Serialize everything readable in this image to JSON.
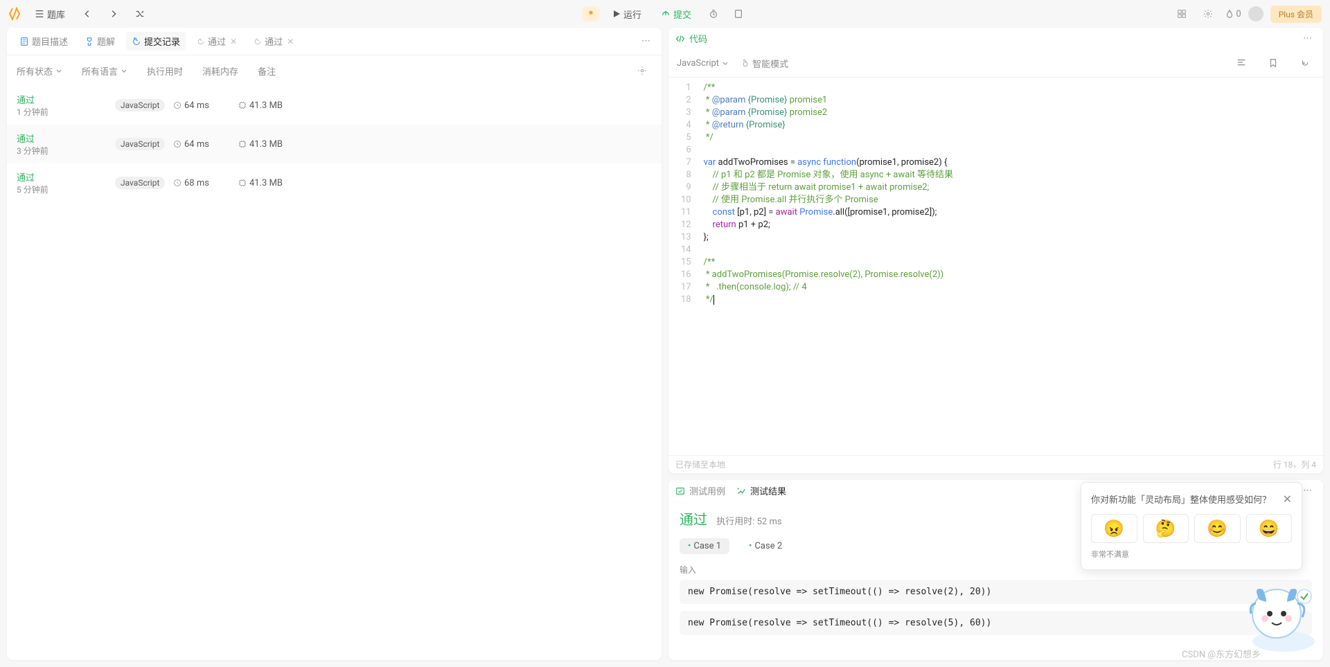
{
  "topbar": {
    "problems_label": "题库",
    "run_label": "运行",
    "submit_label": "提交",
    "fire_count": "0",
    "plus_label": "Plus 会员"
  },
  "left_tabs": {
    "desc": "题目描述",
    "solution": "题解",
    "submissions": "提交记录",
    "accepted1": "通过",
    "accepted2": "通过"
  },
  "filters": {
    "status": "所有状态",
    "lang": "所有语言",
    "runtime": "执行用时",
    "memory": "消耗内存",
    "notes": "备注"
  },
  "submissions": [
    {
      "status": "通过",
      "ago": "1 分钟前",
      "lang": "JavaScript",
      "time": "64 ms",
      "mem": "41.3 MB"
    },
    {
      "status": "通过",
      "ago": "3 分钟前",
      "lang": "JavaScript",
      "time": "64 ms",
      "mem": "41.3 MB"
    },
    {
      "status": "通过",
      "ago": "5 分钟前",
      "lang": "JavaScript",
      "time": "68 ms",
      "mem": "41.3 MB"
    }
  ],
  "code_header": {
    "title": "代码",
    "lang": "JavaScript",
    "smart_mode": "智能模式"
  },
  "code_lines": [
    {
      "n": 1,
      "html": "<span class='c-comment'>/**</span>"
    },
    {
      "n": 2,
      "html": "<span class='c-comment'> * </span><span class='c-tag'>@param</span><span class='c-comment'> </span><span class='c-type'>{Promise}</span><span class='c-comment'> promise1</span>"
    },
    {
      "n": 3,
      "html": "<span class='c-comment'> * </span><span class='c-tag'>@param</span><span class='c-comment'> </span><span class='c-type'>{Promise}</span><span class='c-comment'> promise2</span>"
    },
    {
      "n": 4,
      "html": "<span class='c-comment'> * </span><span class='c-tag'>@return</span><span class='c-comment'> </span><span class='c-type'>{Promise}</span>"
    },
    {
      "n": 5,
      "html": "<span class='c-comment'> */</span>"
    },
    {
      "n": 6,
      "html": ""
    },
    {
      "n": 7,
      "html": "<span class='c-kw2'>var</span> addTwoPromises <span class='c-op'>=</span> <span class='c-kw2'>async</span> <span class='c-kw2'>function</span>(promise1<span class='c-op'>,</span> promise2) {"
    },
    {
      "n": 8,
      "html": "    <span class='c-comment'>// p1 和 p2 都是 Promise 对象，使用 async + await 等待结果</span>"
    },
    {
      "n": 9,
      "html": "    <span class='c-comment'>// 步骤相当于 return await promise1 + await promise2;</span>"
    },
    {
      "n": 10,
      "html": "    <span class='c-comment'>// 使用 Promise.all 并行执行多个 Promise</span>"
    },
    {
      "n": 11,
      "html": "    <span class='c-kw2'>const</span> [p1<span class='c-op'>,</span> p2] <span class='c-op'>=</span> <span class='c-kw'>await</span> <span class='c-fn'>Promise</span>.all([promise1, promise2]);"
    },
    {
      "n": 12,
      "html": "    <span class='c-kw'>return</span> p1 <span class='c-op'>+</span> p2;"
    },
    {
      "n": 13,
      "html": "};"
    },
    {
      "n": 14,
      "html": ""
    },
    {
      "n": 15,
      "html": "<span class='c-comment'>/**</span>"
    },
    {
      "n": 16,
      "html": "<span class='c-comment'> * addTwoPromises(Promise.resolve(2), Promise.resolve(2))</span>"
    },
    {
      "n": 17,
      "html": "<span class='c-comment'> *   .then(console.log); // 4</span>"
    },
    {
      "n": 18,
      "html": "<span class='c-comment'> */</span><span class='cursor-bar'></span>"
    }
  ],
  "code_status": {
    "saved": "已存储至本地",
    "cursor": "行 18，列 4"
  },
  "results": {
    "testcase_tab": "测试用例",
    "result_tab": "测试结果",
    "status": "通过",
    "runtime_label": "执行用时: 52 ms",
    "cases": [
      "Case 1",
      "Case 2"
    ],
    "input_label": "输入",
    "inputs": [
      "new Promise(resolve => setTimeout(() => resolve(2), 20))",
      "new Promise(resolve => setTimeout(() => resolve(5), 60))"
    ]
  },
  "feedback": {
    "question": "你对新功能「灵动布局」整体使用感受如何？",
    "emojis": [
      "😠",
      "🤔",
      "😊",
      "😄"
    ],
    "low_label": "非常不满意"
  },
  "watermark": "CSDN @东方幻想乡"
}
